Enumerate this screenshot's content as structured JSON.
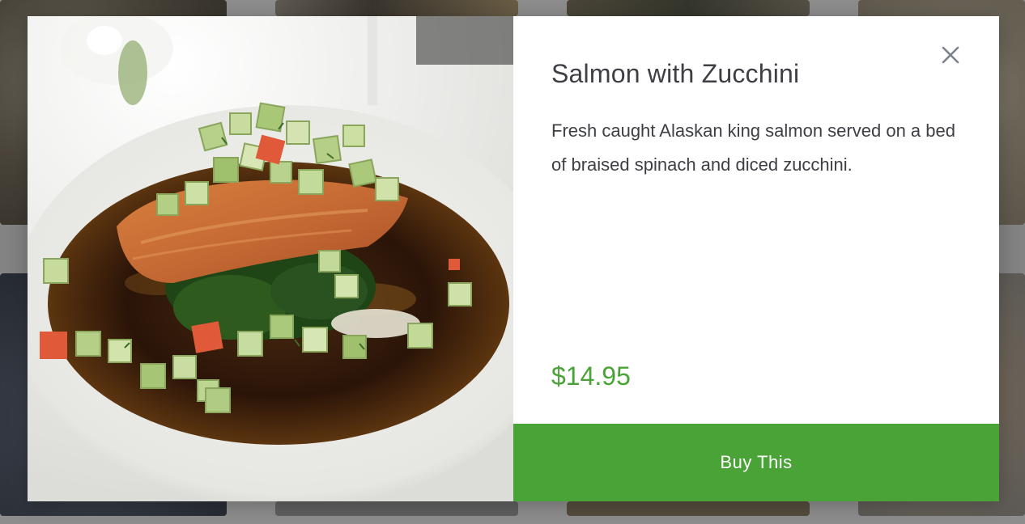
{
  "product": {
    "title": "Salmon with Zucchini",
    "description": "Fresh caught Alaskan king salmon served on a bed of braised spinach and diced zucchini.",
    "price": "$14.95",
    "buy_label": "Buy This"
  },
  "icons": {
    "close": "close-icon"
  },
  "colors": {
    "accent": "#4aa336",
    "text": "#3d3f44",
    "icon": "#7c828c"
  }
}
